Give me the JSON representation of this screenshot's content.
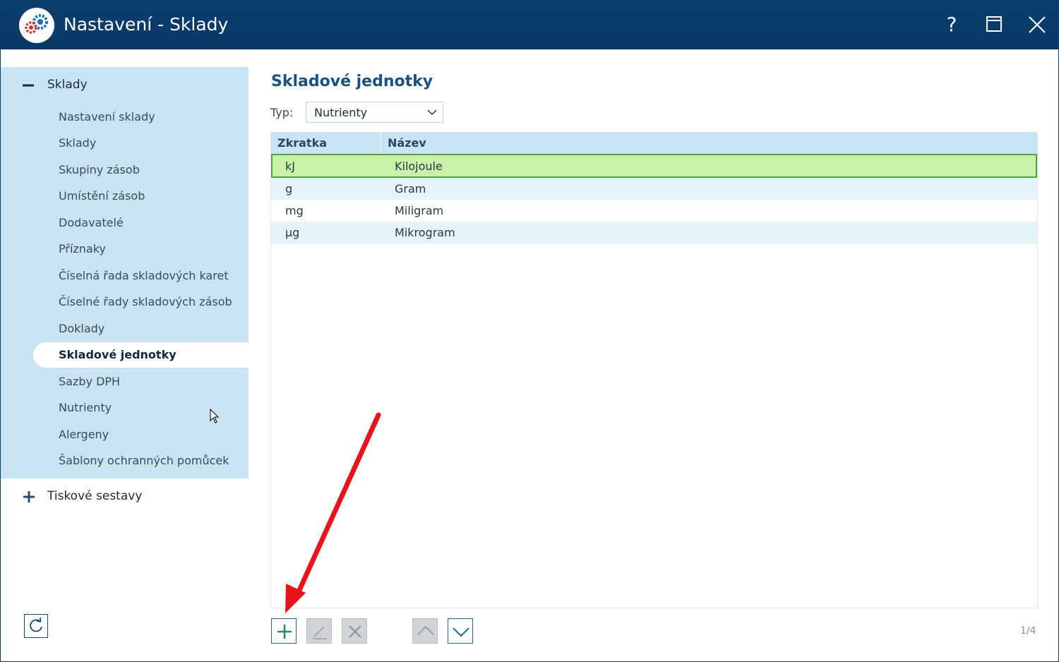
{
  "window": {
    "title": "Nastavení - Sklady",
    "controls": {
      "help": "?",
      "maximize_icon": "maximize-icon",
      "close_icon": "close-icon"
    }
  },
  "sidebar": {
    "groups": [
      {
        "label": "Sklady",
        "expanded": true,
        "items": [
          {
            "label": "Nastavení sklady",
            "active": false
          },
          {
            "label": "Sklady",
            "active": false
          },
          {
            "label": "Skupiny zásob",
            "active": false
          },
          {
            "label": "Umístění zásob",
            "active": false
          },
          {
            "label": "Dodavatelé",
            "active": false
          },
          {
            "label": "Příznaky",
            "active": false
          },
          {
            "label": "Číselná řada skladových karet",
            "active": false
          },
          {
            "label": "Číselné řady skladových zásob",
            "active": false
          },
          {
            "label": "Doklady",
            "active": false
          },
          {
            "label": "Skladové jednotky",
            "active": true
          },
          {
            "label": "Sazby DPH",
            "active": false
          },
          {
            "label": "Nutrienty",
            "active": false
          },
          {
            "label": "Alergeny",
            "active": false
          },
          {
            "label": "Šablony ochranných pomůcek",
            "active": false
          }
        ]
      },
      {
        "label": "Tiskové sestavy",
        "expanded": false,
        "items": []
      }
    ],
    "refresh_icon": "refresh-icon"
  },
  "main": {
    "heading": "Skladové jednotky",
    "filter": {
      "label": "Typ:",
      "value": "Nutrienty"
    },
    "table": {
      "columns": [
        "Zkratka",
        "Název"
      ],
      "rows": [
        {
          "abbr": "kJ",
          "name": "Kilojoule",
          "selected": true
        },
        {
          "abbr": "g",
          "name": "Gram",
          "selected": false
        },
        {
          "abbr": "mg",
          "name": "Miligram",
          "selected": false
        },
        {
          "abbr": "µg",
          "name": "Mikrogram",
          "selected": false
        }
      ]
    },
    "toolbar": {
      "add_icon": "plus-icon",
      "edit_icon": "pencil-icon",
      "delete_icon": "x-icon",
      "up_icon": "chevron-up-icon",
      "down_icon": "chevron-down-icon",
      "counter": "1/4"
    }
  },
  "colors": {
    "titlebar": "#0b3f6f",
    "sidebar_group": "#c8e3f2",
    "selected_row": "#c9f1a8",
    "selected_border": "#49a63a",
    "heading": "#1c5080",
    "annotation_arrow": "#e8141c"
  }
}
